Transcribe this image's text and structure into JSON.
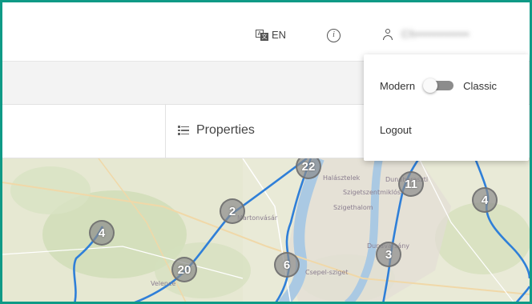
{
  "header": {
    "language_label": "EN",
    "language_icon": "translate-icon",
    "info_icon": "info-icon",
    "user_icon": "user-icon",
    "user_name": "Ch••••••••••••"
  },
  "panel": {
    "properties_label": "Properties",
    "properties_icon": "list-icon"
  },
  "user_menu": {
    "toggle_left_label": "Modern",
    "toggle_right_label": "Classic",
    "toggle_state": "Modern",
    "logout_label": "Logout"
  },
  "map": {
    "clusters": [
      "22",
      "11",
      "2",
      "4",
      "4",
      "20",
      "6",
      "3"
    ],
    "labels": [
      "Halásztelek",
      "Szigetszentmiklós",
      "Szigethalom",
      "Dunaharaszti",
      "Dunavarsány",
      "Csepel-sziget",
      "Velence",
      "Martonvásár"
    ]
  },
  "colors": {
    "accent_border": "#0f9a86",
    "route": "#2f7fd8",
    "map_background": "#e9ead7",
    "cluster_fill": "#8c8c8c"
  }
}
